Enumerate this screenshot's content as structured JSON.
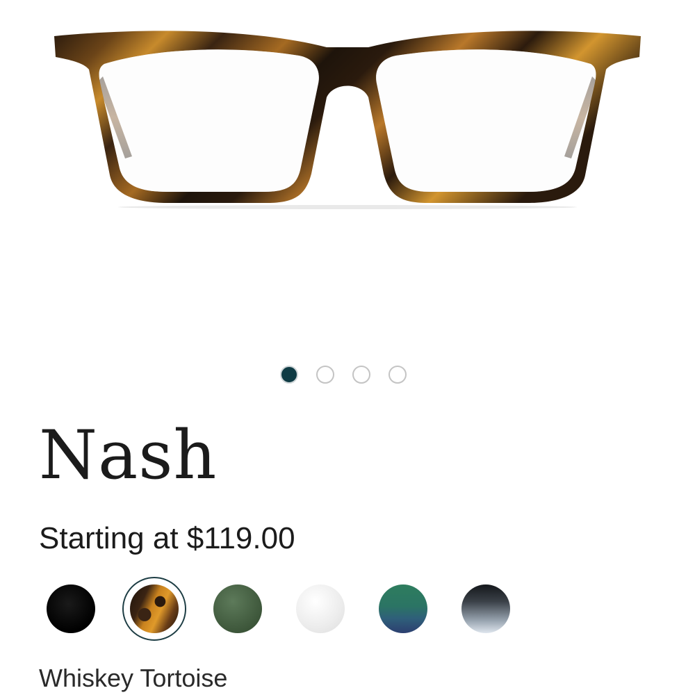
{
  "product": {
    "name": "Nash",
    "price_text": "Starting at $119.00",
    "selected_color": "Whiskey Tortoise"
  },
  "gallery": {
    "image_count": 4,
    "active_index": 0
  },
  "swatches": [
    {
      "color": "black",
      "selected": false
    },
    {
      "color": "tortoise",
      "selected": true
    },
    {
      "color": "green",
      "selected": false
    },
    {
      "color": "clear",
      "selected": false
    },
    {
      "color": "teal-blue gradient",
      "selected": false
    },
    {
      "color": "grey gradient",
      "selected": false
    }
  ],
  "colors": {
    "active_dot": "#0f3b44",
    "selected_ring": "#1d3d44",
    "text": "#1b1b1b"
  }
}
